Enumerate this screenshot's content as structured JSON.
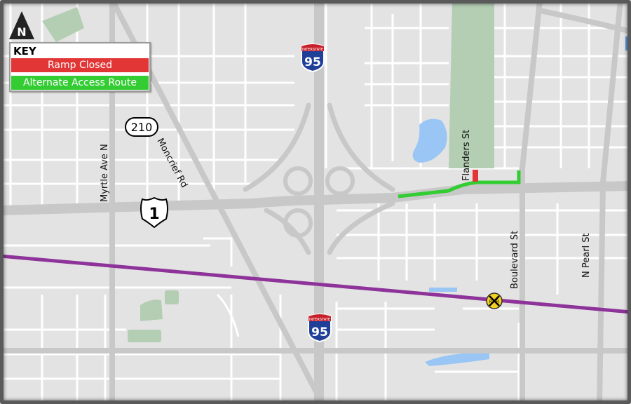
{
  "legend": {
    "title": "KEY",
    "items": [
      {
        "label": "Ramp Closed",
        "color": "#e23636"
      },
      {
        "label": "Alternate Access Route",
        "color": "#33cc33"
      }
    ]
  },
  "north_arrow": {
    "label": "N",
    "icon": "north-arrow-icon"
  },
  "streets": {
    "myrtle": "Myrtle Ave N",
    "moncrief": "Moncrief Rd",
    "flanders": "Flanders St",
    "boulevard": "Boulevard St",
    "pearl": "N Pearl St"
  },
  "shields": {
    "interstate_top": {
      "header": "INTERSTATE",
      "number": "95"
    },
    "interstate_bottom": {
      "header": "INTERSTATE",
      "number": "95"
    },
    "state_road": {
      "number": "210"
    },
    "us_route": {
      "number": "1"
    },
    "railroad": {
      "label": "R R"
    }
  },
  "colors": {
    "land": "#e3e3e3",
    "local_road": "#ffffff",
    "major_road": "#c8c8c8",
    "park": "#b3ceb3",
    "water": "#99c6f5",
    "railroad": "#8e3399",
    "closed": "#e23636",
    "alternate": "#33cc33"
  }
}
